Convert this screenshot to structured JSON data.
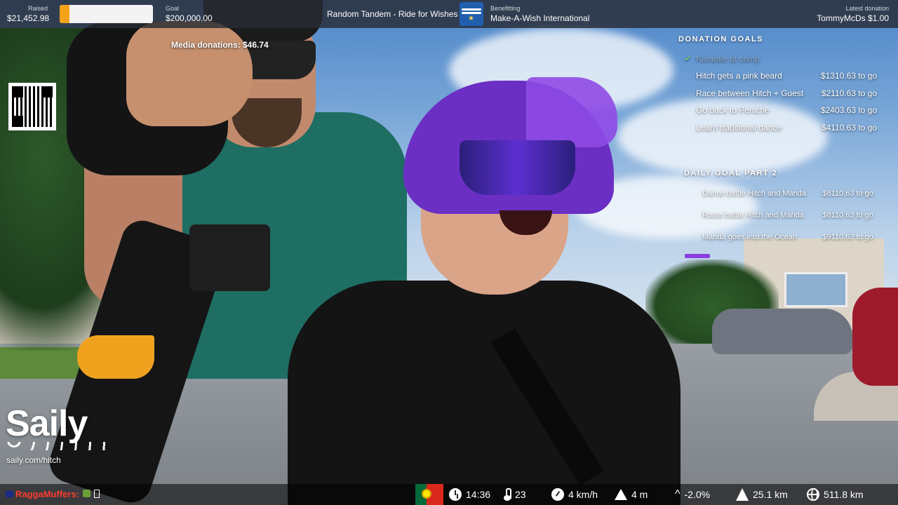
{
  "topbar": {
    "raised_label": "Raised",
    "raised_value": "$21,452.98",
    "progress_fraction": 0.107,
    "goal_label": "Goal",
    "goal_value": "$200,000.00",
    "stream_title": "Random Tandem - Ride for Wishes",
    "charity_logo_text": "Make-A-Wish",
    "benefitting_label": "Benefitting",
    "benefitting_value": "Make-A-Wish International",
    "latest_label": "Latest donation",
    "latest_value": "TommyMcDs $1.00"
  },
  "media_donations": "Media donations: $46.74",
  "sponsor": {
    "logo_text": "Saily",
    "url": "saily.com/hitch"
  },
  "donation_goals": {
    "heading": "DONATION GOALS",
    "items": [
      {
        "name": "Karaoke at camp",
        "amount": "",
        "completed": true
      },
      {
        "name": "Hitch gets a pink beard",
        "amount": "$1310.63 to go",
        "completed": false
      },
      {
        "name": "Race between Hitch + Guest",
        "amount": "$2110.63 to go",
        "completed": false
      },
      {
        "name": "Go back to Peniche",
        "amount": "$2403.63 to go",
        "completed": false
      },
      {
        "name": "Learn traditional dance",
        "amount": "$4110.63 to go",
        "completed": false
      }
    ]
  },
  "daily_goals": {
    "heading": "DAILY GOAL PART 2",
    "items": [
      {
        "name": "Dance battle Hitch and Manda",
        "amount": "$6110.63 to go"
      },
      {
        "name": "Roast battle Hitch and Manda",
        "amount": "$8110.63 to go"
      },
      {
        "name": "Manda goes into the Ocean",
        "amount": "$9110.63 to go"
      }
    ]
  },
  "chat": {
    "username": "RaggaMuffers:"
  },
  "telemetry": {
    "time": "14:36",
    "temperature": "23",
    "speed": "4 km/h",
    "elevation": "4 m",
    "gradient": "-2.0%",
    "distance_today": "25.1 km",
    "distance_total": "511.8 km"
  },
  "colors": {
    "progress_fill": "#f3a21a",
    "chat_username": "#ff3b30",
    "goal_check": "#6ad26a"
  },
  "icons": [
    "clock-icon",
    "thermometer-icon",
    "speedometer-icon",
    "mountain-icon",
    "gradient-caret-icon",
    "road-icon",
    "globe-icon",
    "portugal-flag-icon"
  ]
}
